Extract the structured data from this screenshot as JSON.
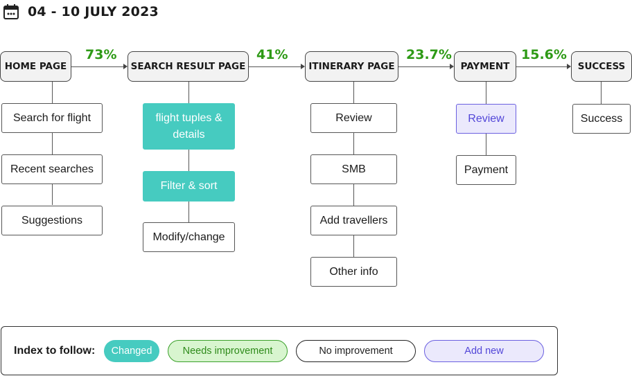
{
  "header": {
    "date_range": "04 - 10 JULY 2023"
  },
  "stages": [
    {
      "label": "HOME PAGE"
    },
    {
      "label": "SEARCH RESULT PAGE"
    },
    {
      "label": "ITINERARY PAGE"
    },
    {
      "label": "PAYMENT"
    },
    {
      "label": "SUCCESS"
    }
  ],
  "conversions": [
    "73%",
    "41%",
    "23.7%",
    "15.6%"
  ],
  "steps": {
    "home": [
      "Search for flight",
      "Recent searches",
      "Suggestions"
    ],
    "search": [
      "flight tuples & details",
      "Filter & sort",
      "Modify/change"
    ],
    "itinerary": [
      "Review",
      "SMB",
      "Add travellers",
      "Other info"
    ],
    "payment": [
      "Review",
      "Payment"
    ],
    "success": [
      "Success"
    ]
  },
  "legend": {
    "label": "Index to follow:",
    "items": [
      "Changed",
      "Needs improvement",
      "No improvement",
      "Add new"
    ]
  },
  "colors": {
    "changed": "#46cbc0",
    "needs_improvement": "#d8f5cf",
    "add_new": "#ebe9fc",
    "conversion": "#2e9a16"
  }
}
